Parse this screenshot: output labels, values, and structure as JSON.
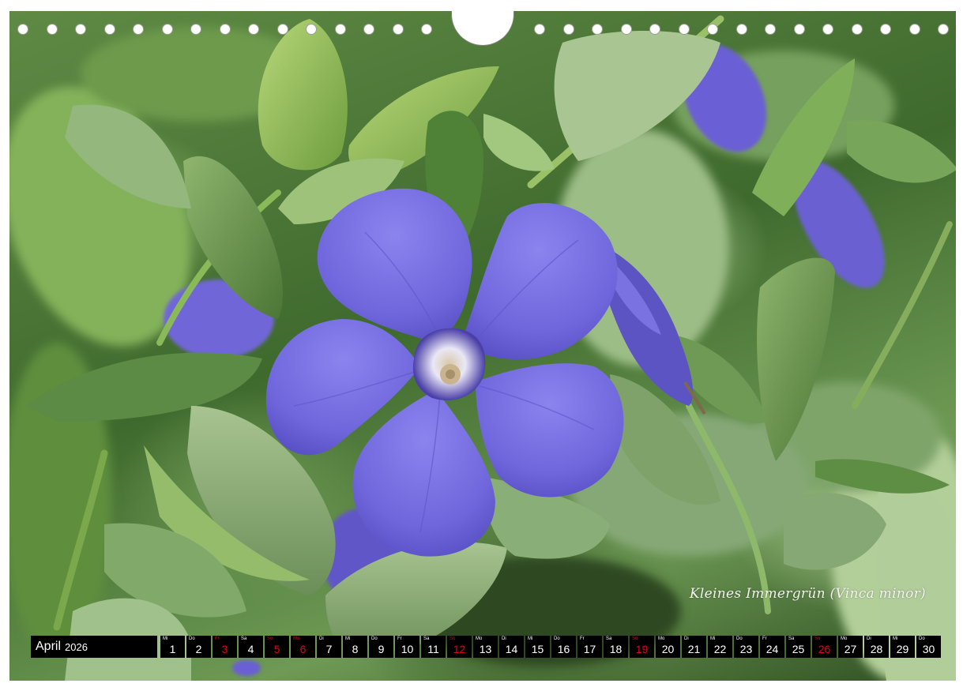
{
  "photo": {
    "subject": "purple five-petal periwinkle flower among green leaves",
    "colors": {
      "petal": "#7b72e2",
      "petal_dark": "#5b4fc4",
      "leaf": "#6f9a4f",
      "leaf_light": "#a6c96a",
      "background": "#3f6a2e"
    }
  },
  "caption": "Kleines Immergrün  (Vinca minor)",
  "calendar": {
    "month": "April",
    "year": "2026",
    "days": [
      {
        "wd": "Mi",
        "d": "1",
        "h": false
      },
      {
        "wd": "Do",
        "d": "2",
        "h": false
      },
      {
        "wd": "Fr",
        "d": "3",
        "h": true
      },
      {
        "wd": "Sa",
        "d": "4",
        "h": false
      },
      {
        "wd": "So",
        "d": "5",
        "h": true
      },
      {
        "wd": "Mo",
        "d": "6",
        "h": true
      },
      {
        "wd": "Di",
        "d": "7",
        "h": false
      },
      {
        "wd": "Mi",
        "d": "8",
        "h": false
      },
      {
        "wd": "Do",
        "d": "9",
        "h": false
      },
      {
        "wd": "Fr",
        "d": "10",
        "h": false
      },
      {
        "wd": "Sa",
        "d": "11",
        "h": false
      },
      {
        "wd": "So",
        "d": "12",
        "h": true
      },
      {
        "wd": "Mo",
        "d": "13",
        "h": false
      },
      {
        "wd": "Di",
        "d": "14",
        "h": false
      },
      {
        "wd": "Mi",
        "d": "15",
        "h": false
      },
      {
        "wd": "Do",
        "d": "16",
        "h": false
      },
      {
        "wd": "Fr",
        "d": "17",
        "h": false
      },
      {
        "wd": "Sa",
        "d": "18",
        "h": false
      },
      {
        "wd": "So",
        "d": "19",
        "h": true
      },
      {
        "wd": "Mo",
        "d": "20",
        "h": false
      },
      {
        "wd": "Di",
        "d": "21",
        "h": false
      },
      {
        "wd": "Mi",
        "d": "22",
        "h": false
      },
      {
        "wd": "Do",
        "d": "23",
        "h": false
      },
      {
        "wd": "Fr",
        "d": "24",
        "h": false
      },
      {
        "wd": "Sa",
        "d": "25",
        "h": false
      },
      {
        "wd": "So",
        "d": "26",
        "h": true
      },
      {
        "wd": "Mo",
        "d": "27",
        "h": false
      },
      {
        "wd": "Di",
        "d": "28",
        "h": false
      },
      {
        "wd": "Mi",
        "d": "29",
        "h": false
      },
      {
        "wd": "Do",
        "d": "30",
        "h": false
      }
    ]
  }
}
